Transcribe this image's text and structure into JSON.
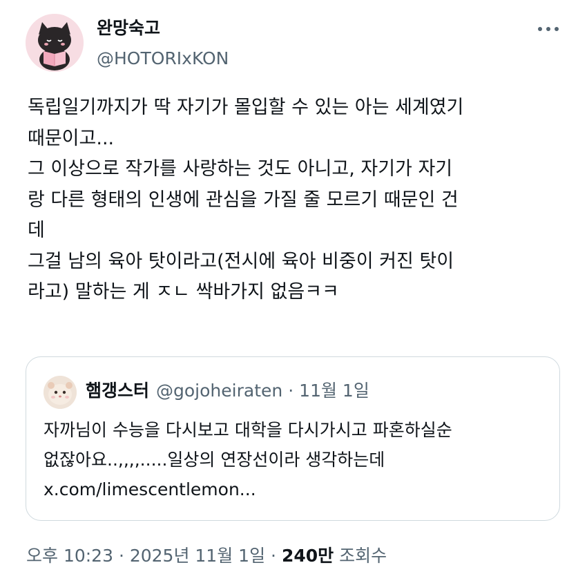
{
  "author": {
    "display_name": "완망숙고",
    "handle": "@HOTORIxKON",
    "avatar_icon": "black-cat-reading-book-avatar"
  },
  "more_icon": "more-dots-icon",
  "post": {
    "text": "독립일기까지가 딱 자기가 몰입할 수 있는 아는 세계였기\n때문이고...\n그 이상으로 작가를 사랑하는 것도 아니고, 자기가 자기\n랑 다른 형태의 인생에 관심을 가질 줄 모르기 때문인 건\n데\n그걸 남의 육아 탓이라고(전시에 육아 비중이 커진 탓이\n라고) 말하는 게 ㅈㄴ 싹바가지 없음ㅋㅋ"
  },
  "quote": {
    "display_name": "햄갱스터",
    "handle": "@gojoheiraten",
    "separator": "·",
    "date": "11월 1일",
    "avatar_icon": "hamster-avatar",
    "text": "자까님이 수능을 다시보고 대학을 다시가시고 파혼하실순\n없잖아요..,,,,.....일상의 연장선이라 생각하는데\nx.com/limescentlemon..."
  },
  "meta": {
    "timestamp": "오후 10:23 · 2025년 11월 1일",
    "separator": "·",
    "views_count": "240만",
    "views_label": "조회수"
  },
  "colors": {
    "text_primary": "#0f1419",
    "text_secondary": "#536471",
    "border": "#cfd9de",
    "avatar_bg": "#f7dde3"
  }
}
